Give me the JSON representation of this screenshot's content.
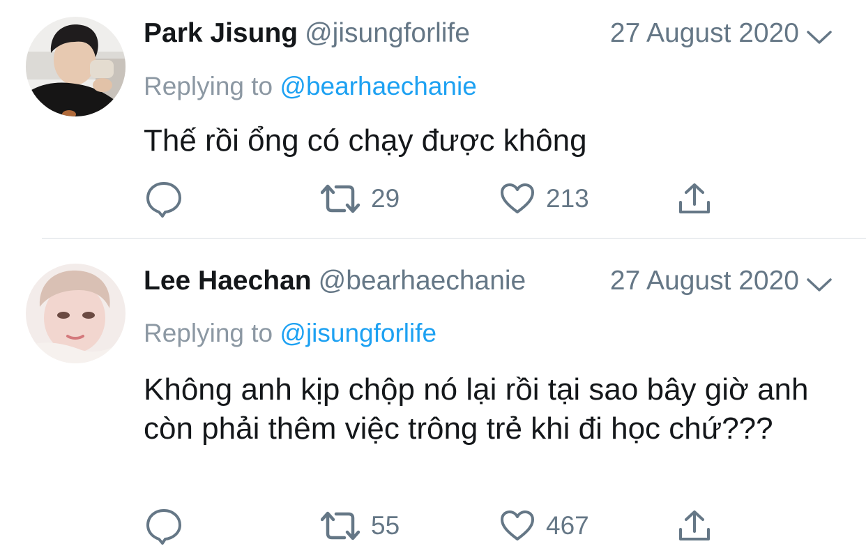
{
  "tweets": [
    {
      "display_name": "Park Jisung",
      "handle": "@jisungforlife",
      "date": "27 August 2020",
      "replying_prefix": "Replying to",
      "replying_to": "@bearhaechanie",
      "text": "Thế rồi ổng có chạy được không",
      "retweets": "29",
      "likes": "213"
    },
    {
      "display_name": "Lee Haechan",
      "handle": "@bearhaechanie",
      "date": "27 August 2020",
      "replying_prefix": "Replying to",
      "replying_to": "@jisungforlife",
      "text": "Không anh kịp chộp nó lại rồi tại sao bây giờ anh còn phải thêm việc trông trẻ khi đi học chứ???",
      "retweets": "55",
      "likes": "467"
    }
  ],
  "icons": {
    "reply": "speech-bubble-icon",
    "retweet": "retweet-icon",
    "like": "heart-icon",
    "share": "share-icon",
    "menu": "chevron-down-icon"
  },
  "colors": {
    "text": "#14171a",
    "secondary": "#657786",
    "mention": "#1da1f2",
    "icon": "#657786",
    "divider": "#d6dce1"
  }
}
